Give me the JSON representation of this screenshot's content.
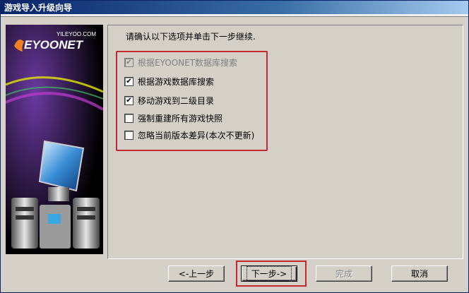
{
  "window": {
    "title": "游戏导入升级向导"
  },
  "side_panel": {
    "brand_url": "YILEYOO.COM",
    "brand_name": "EYOONET"
  },
  "content": {
    "instruction": "请确认以下选项并单击下一步继续.",
    "options": [
      {
        "label": "根据EYOONET数据库搜索",
        "checked": true,
        "disabled": true
      },
      {
        "label": "根据游戏数据库搜索",
        "checked": true,
        "disabled": false
      },
      {
        "label": "移动游戏到二级目录",
        "checked": true,
        "disabled": false
      },
      {
        "label": "强制重建所有游戏快照",
        "checked": false,
        "disabled": false
      },
      {
        "label": "忽略当前版本差异(本次不更新)",
        "checked": false,
        "disabled": false
      }
    ]
  },
  "buttons": {
    "back": "<-上一步",
    "next": "下一步->",
    "finish": "完成",
    "cancel": "取消"
  },
  "colors": {
    "highlight_border": "#c0282d",
    "title_bar": "#0a246a"
  }
}
